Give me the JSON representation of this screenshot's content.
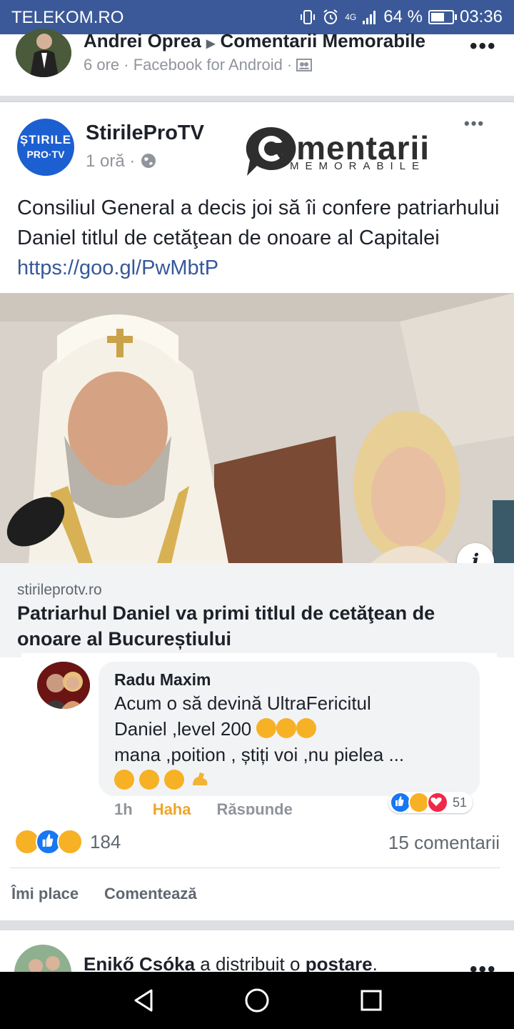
{
  "status_bar": {
    "carrier": "TELEKOM.RO",
    "network": "4G",
    "battery_text": "64 %",
    "battery_level": 0.64,
    "time": "03:36"
  },
  "shared_post": {
    "author": "Andrei Oprea",
    "target": "Comentarii Memorabile",
    "meta": "6 ore · Facebook for Android ·",
    "more_label": "•••"
  },
  "original_post": {
    "page_name": "StirileProTV",
    "logo_line1": "ȘTIRILE",
    "logo_line2": "PRO·TV",
    "time": "1 oră ·",
    "watermark_main": "omentarii",
    "watermark_sub": "MEMORABILE",
    "more_label": "•••",
    "text": "Consiliul General a decis joi să îi confere patriarhului Daniel titlul de cetăţean de onoare al Capitalei ",
    "link": "https://goo.gl/PwMbtP",
    "link_domain": "stirileprotv.ro",
    "link_title": "Patriarhul Daniel va primi titlul de cetăţean de onoare al Bucureștiului",
    "info_label": "i"
  },
  "comment": {
    "author": "Radu Maxim",
    "line1": "Acum o să devină UltraFericitul",
    "line2": "Daniel ,level 200",
    "line3": "mana ,poition , știți voi ,nu pielea ...",
    "time": "1h",
    "haha_label": "Haha",
    "reply_label": "Răspunde",
    "reaction_count": "51"
  },
  "footer": {
    "reaction_count": "184",
    "comments_count": "15 comentarii",
    "like_label": "Îmi place",
    "comment_label": "Comentează"
  },
  "next_post": {
    "author": "Enikő Csóka",
    "action": " a distribuit o ",
    "object": "postare",
    "punct": "."
  },
  "colors": {
    "status_bar": "#3b5998",
    "link": "#365899",
    "haha": "#f0a429",
    "like_blue": "#1877f2",
    "love_red": "#f0284a"
  }
}
